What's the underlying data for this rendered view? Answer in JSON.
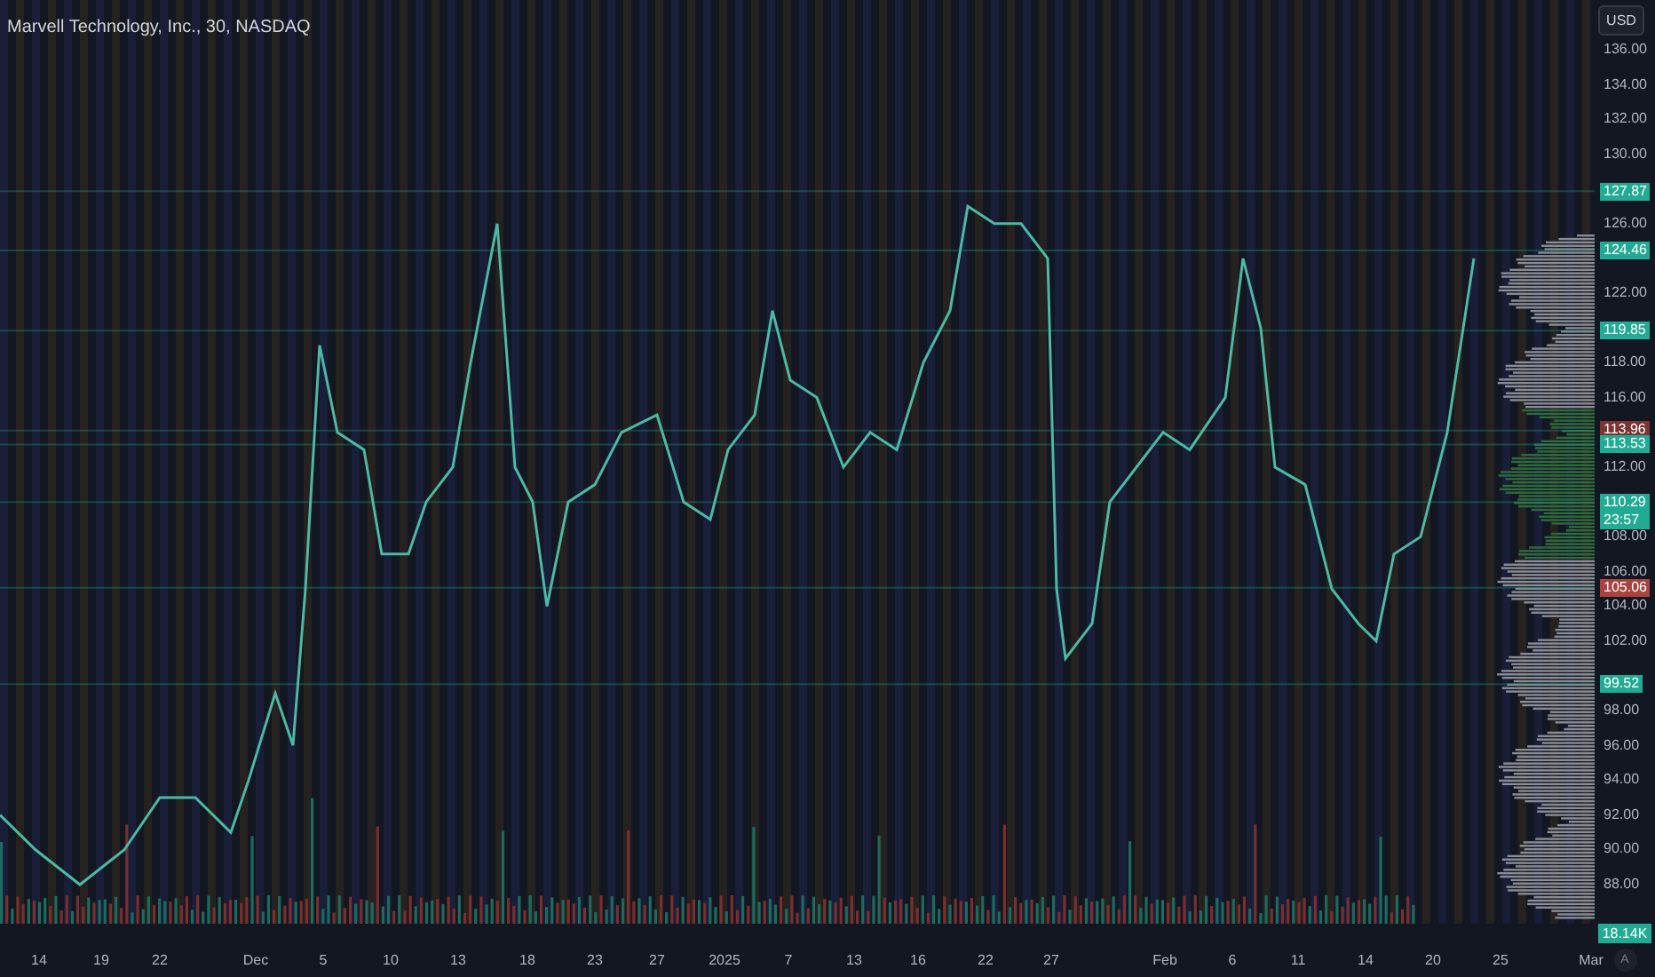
{
  "title": "Marvell Technology, Inc., 30, NASDAQ",
  "currency_button": "USD",
  "price_ticks": [
    "136.00",
    "134.00",
    "132.00",
    "130.00",
    "126.00",
    "122.00",
    "118.00",
    "116.00",
    "112.00",
    "108.00",
    "106.00",
    "104.00",
    "102.00",
    "98.00",
    "96.00",
    "94.00",
    "92.00",
    "90.00",
    "88.00"
  ],
  "price_labels": [
    {
      "text": "127.87",
      "color": "#22ab94"
    },
    {
      "text": "124.46",
      "color": "#22ab94"
    },
    {
      "text": "119.85",
      "color": "#22ab94"
    },
    {
      "text": "113.96",
      "color": "#7a3434"
    },
    {
      "text": "113.53",
      "color": "#22ab94"
    },
    {
      "text": "110.29\n23:57",
      "color": "#22ab94"
    },
    {
      "text": "105.06",
      "color": "#a8443f"
    },
    {
      "text": "99.52",
      "color": "#22ab94"
    }
  ],
  "time_ticks": [
    "14",
    "19",
    "22",
    "Dec",
    "5",
    "10",
    "13",
    "18",
    "23",
    "27",
    "2025",
    "7",
    "13",
    "16",
    "22",
    "27",
    "Feb",
    "6",
    "11",
    "14",
    "20",
    "25",
    "Mar"
  ],
  "volume_label": {
    "text": "18.14K",
    "color": "#22ab94"
  },
  "auto_button": "A"
}
